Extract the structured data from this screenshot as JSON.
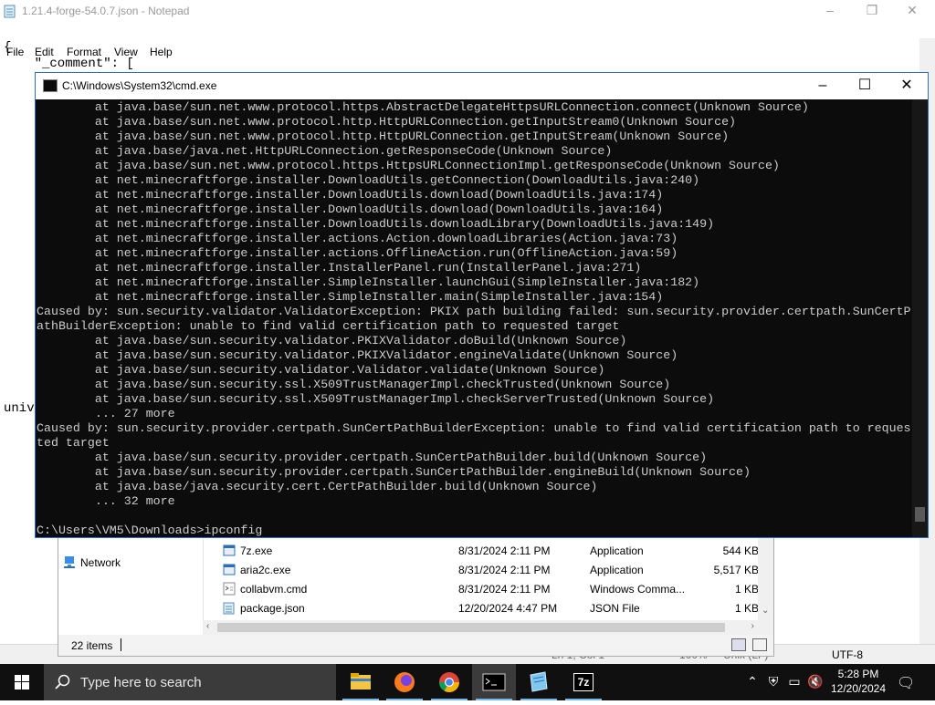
{
  "notepad": {
    "title": "1.21.4-forge-54.0.7.json - Notepad",
    "menu": [
      "File",
      "Edit",
      "Format",
      "View",
      "Help"
    ],
    "text_lines": [
      "{",
      "    \"_comment\": [",
      "univ"
    ],
    "status": {
      "position": "Ln 1, Col 1",
      "zoom": "100%",
      "eol": "Unix (LF)",
      "encoding": "UTF-8"
    }
  },
  "cmd": {
    "title": "C:\\Windows\\System32\\cmd.exe",
    "lines": [
      "        at java.base/sun.net.www.protocol.https.AbstractDelegateHttpsURLConnection.connect(Unknown Source)",
      "        at java.base/sun.net.www.protocol.http.HttpURLConnection.getInputStream0(Unknown Source)",
      "        at java.base/sun.net.www.protocol.http.HttpURLConnection.getInputStream(Unknown Source)",
      "        at java.base/java.net.HttpURLConnection.getResponseCode(Unknown Source)",
      "        at java.base/sun.net.www.protocol.https.HttpsURLConnectionImpl.getResponseCode(Unknown Source)",
      "        at net.minecraftforge.installer.DownloadUtils.getConnection(DownloadUtils.java:240)",
      "        at net.minecraftforge.installer.DownloadUtils.download(DownloadUtils.java:174)",
      "        at net.minecraftforge.installer.DownloadUtils.download(DownloadUtils.java:164)",
      "        at net.minecraftforge.installer.DownloadUtils.downloadLibrary(DownloadUtils.java:149)",
      "        at net.minecraftforge.installer.actions.Action.downloadLibraries(Action.java:73)",
      "        at net.minecraftforge.installer.actions.OfflineAction.run(OfflineAction.java:59)",
      "        at net.minecraftforge.installer.InstallerPanel.run(InstallerPanel.java:271)",
      "        at net.minecraftforge.installer.SimpleInstaller.launchGui(SimpleInstaller.java:182)",
      "        at net.minecraftforge.installer.SimpleInstaller.main(SimpleInstaller.java:154)",
      "Caused by: sun.security.validator.ValidatorException: PKIX path building failed: sun.security.provider.certpath.SunCertP",
      "athBuilderException: unable to find valid certification path to requested target",
      "        at java.base/sun.security.validator.PKIXValidator.doBuild(Unknown Source)",
      "        at java.base/sun.security.validator.PKIXValidator.engineValidate(Unknown Source)",
      "        at java.base/sun.security.validator.Validator.validate(Unknown Source)",
      "        at java.base/sun.security.ssl.X509TrustManagerImpl.checkTrusted(Unknown Source)",
      "        at java.base/sun.security.ssl.X509TrustManagerImpl.checkServerTrusted(Unknown Source)",
      "        ... 27 more",
      "Caused by: sun.security.provider.certpath.SunCertPathBuilderException: unable to find valid certification path to reques",
      "ted target",
      "        at java.base/sun.security.provider.certpath.SunCertPathBuilder.build(Unknown Source)",
      "        at java.base/sun.security.provider.certpath.SunCertPathBuilder.engineBuild(Unknown Source)",
      "        at java.base/java.security.cert.CertPathBuilder.build(Unknown Source)",
      "        ... 32 more",
      "",
      "C:\\Users\\VM5\\Downloads>ipconfig"
    ]
  },
  "explorer": {
    "nav": {
      "network": "Network"
    },
    "files": [
      {
        "name": "7z.exe",
        "date": "8/31/2024 2:11 PM",
        "type": "Application",
        "size": "544 KB",
        "icon": "exe-icon"
      },
      {
        "name": "aria2c.exe",
        "date": "8/31/2024 2:11 PM",
        "type": "Application",
        "size": "5,517 KB",
        "icon": "exe-icon"
      },
      {
        "name": "collabvm.cmd",
        "date": "8/31/2024 2:11 PM",
        "type": "Windows Comma...",
        "size": "1 KB",
        "icon": "cmd-file-icon"
      },
      {
        "name": "package.json",
        "date": "12/20/2024 4:47 PM",
        "type": "JSON File",
        "size": "1 KB",
        "icon": "json-file-icon"
      }
    ],
    "status": {
      "items": "22 items"
    }
  },
  "taskbar": {
    "search_placeholder": "Type here to search",
    "apps": [
      "file-explorer",
      "firefox",
      "chrome",
      "command-prompt",
      "notepad",
      "7-zip"
    ],
    "seven_zip_label": "7z",
    "clock": {
      "time": "5:28 PM",
      "date": "12/20/2024"
    },
    "colors": {
      "accent": "#76b9ed",
      "taskbar": "#101010"
    }
  }
}
